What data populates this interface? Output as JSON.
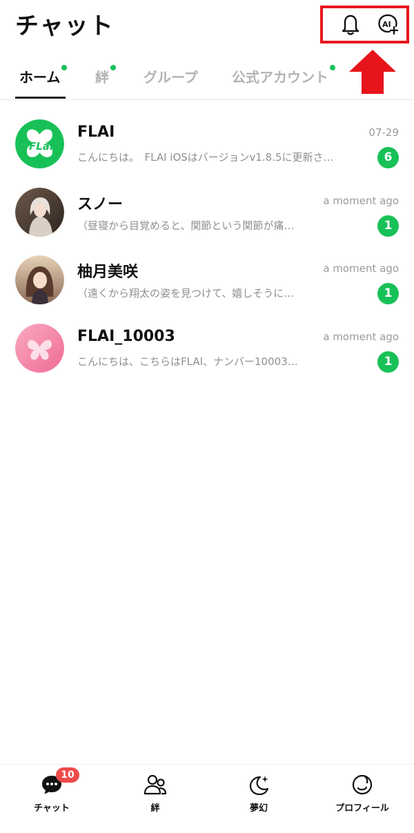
{
  "header": {
    "title": "チャット",
    "bell_icon": "bell-icon",
    "ai_add_icon": "ai-plus-icon",
    "highlight_color": "#e8141c"
  },
  "tabs": [
    {
      "label": "ホーム",
      "active": true,
      "has_dot": true
    },
    {
      "label": "絆",
      "active": false,
      "has_dot": true
    },
    {
      "label": "グループ",
      "active": false,
      "has_dot": false
    },
    {
      "label": "公式アカウント",
      "active": false,
      "has_dot": true
    }
  ],
  "chats": [
    {
      "name": "FLAI",
      "time": "07-29",
      "preview": "こんにちは。　FLAI iOSはバージョンv1.8.5に更新さ…",
      "unread": "6",
      "avatar_logo_text": "FLai"
    },
    {
      "name": "スノー",
      "time": "a moment ago",
      "preview": "（昼寝から目覚めると、関節という関節が痛…",
      "unread": "1"
    },
    {
      "name": "柚月美咲",
      "time": "a moment ago",
      "preview": "（遠くから翔太の姿を見つけて、嬉しそうに…",
      "unread": "1"
    },
    {
      "name": "FLAI_10003",
      "time": "a moment ago",
      "preview": "こんにちは、こちらはFLAI、ナンバー10003…",
      "unread": "1"
    }
  ],
  "bottom_nav": [
    {
      "label": "チャット",
      "icon": "chat-bubble-icon",
      "badge": "10"
    },
    {
      "label": "絆",
      "icon": "people-icon"
    },
    {
      "label": "夢幻",
      "icon": "moon-sparkle-icon"
    },
    {
      "label": "プロフィール",
      "icon": "profile-circle-icon"
    }
  ],
  "colors": {
    "accent_green": "#18c158",
    "badge_red": "#f04a4a"
  }
}
